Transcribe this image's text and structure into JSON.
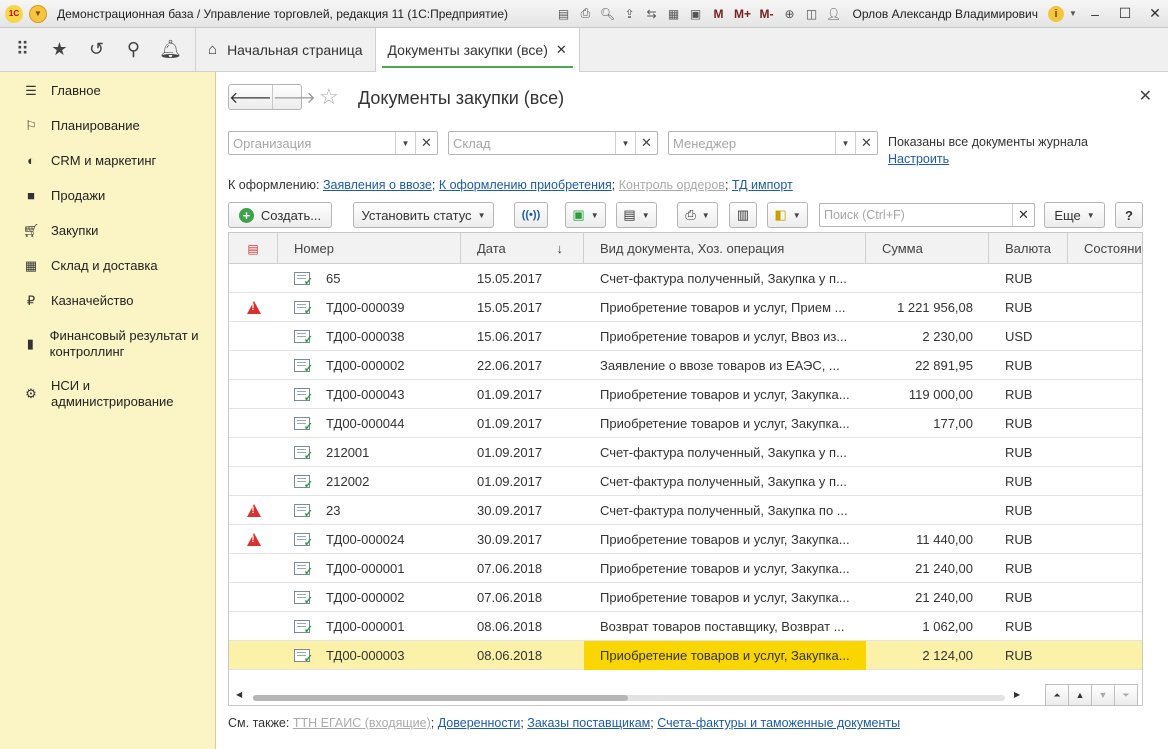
{
  "window": {
    "title": "Демонстрационная база / Управление торговлей, редакция 11  (1С:Предприятие)",
    "user": "Орлов Александр Владимирович",
    "toolbar_icons": [
      "save-icon",
      "print-icon",
      "preview-icon",
      "upload-icon",
      "compare-icon",
      "calculator-icon",
      "calendar-icon"
    ],
    "memory_labels": [
      "M",
      "M+",
      "M-"
    ]
  },
  "tabs": {
    "home": "Начальная страница",
    "active": "Документы закупки (все)"
  },
  "sidebar": {
    "items": [
      {
        "label": "Главное",
        "icon": "menu-icon"
      },
      {
        "label": "Планирование",
        "icon": "planning-icon"
      },
      {
        "label": "CRM и маркетинг",
        "icon": "crm-icon"
      },
      {
        "label": "Продажи",
        "icon": "bag-icon"
      },
      {
        "label": "Закупки",
        "icon": "cart-icon"
      },
      {
        "label": "Склад и доставка",
        "icon": "warehouse-icon"
      },
      {
        "label": "Казначейство",
        "icon": "ruble-icon"
      },
      {
        "label": "Финансовый результат и контроллинг",
        "icon": "chart-icon"
      },
      {
        "label": "НСИ и администрирование",
        "icon": "gear-icon"
      }
    ]
  },
  "page": {
    "title": "Документы закупки (все)"
  },
  "filters": {
    "org_placeholder": "Организация",
    "warehouse_placeholder": "Склад",
    "manager_placeholder": "Менеджер",
    "journal_info": "Показаны все документы журнала",
    "configure_link": "Настроить"
  },
  "process": {
    "label": "К оформлению:",
    "links": [
      "Заявления о ввозе",
      "К оформлению приобретения",
      "Контроль ордеров",
      "ТД импорт"
    ]
  },
  "toolbar": {
    "create": "Создать...",
    "set_status": "Установить статус",
    "search_placeholder": "Поиск (Ctrl+F)",
    "more": "Еще",
    "help": "?"
  },
  "table": {
    "columns": [
      "Номер",
      "Дата",
      "Вид документа, Хоз. операция",
      "Сумма",
      "Валюта",
      "Состояние"
    ],
    "rows": [
      {
        "warn": false,
        "num": "65",
        "date": "15.05.2017",
        "kind": "Счет-фактура полученный, Закупка у п...",
        "sum": "",
        "cur": "RUB"
      },
      {
        "warn": true,
        "num": "ТД00-000039",
        "date": "15.05.2017",
        "kind": "Приобретение товаров и услуг, Прием ...",
        "sum": "1 221 956,08",
        "cur": "RUB"
      },
      {
        "warn": false,
        "num": "ТД00-000038",
        "date": "15.06.2017",
        "kind": "Приобретение товаров и услуг, Ввоз из...",
        "sum": "2 230,00",
        "cur": "USD"
      },
      {
        "warn": false,
        "num": "ТД00-000002",
        "date": "22.06.2017",
        "kind": "Заявление о ввозе товаров из ЕАЭС, ...",
        "sum": "22 891,95",
        "cur": "RUB"
      },
      {
        "warn": false,
        "num": "ТД00-000043",
        "date": "01.09.2017",
        "kind": "Приобретение товаров и услуг, Закупка...",
        "sum": "119 000,00",
        "cur": "RUB"
      },
      {
        "warn": false,
        "num": "ТД00-000044",
        "date": "01.09.2017",
        "kind": "Приобретение товаров и услуг, Закупка...",
        "sum": "177,00",
        "cur": "RUB"
      },
      {
        "warn": false,
        "num": "212001",
        "date": "01.09.2017",
        "kind": "Счет-фактура полученный, Закупка у п...",
        "sum": "",
        "cur": "RUB"
      },
      {
        "warn": false,
        "num": "212002",
        "date": "01.09.2017",
        "kind": "Счет-фактура полученный, Закупка у п...",
        "sum": "",
        "cur": "RUB"
      },
      {
        "warn": true,
        "num": "23",
        "date": "30.09.2017",
        "kind": "Счет-фактура полученный, Закупка по ...",
        "sum": "",
        "cur": "RUB"
      },
      {
        "warn": true,
        "num": "ТД00-000024",
        "date": "30.09.2017",
        "kind": "Приобретение товаров и услуг, Закупка...",
        "sum": "11 440,00",
        "cur": "RUB"
      },
      {
        "warn": false,
        "num": "ТД00-000001",
        "date": "07.06.2018",
        "kind": "Приобретение товаров и услуг, Закупка...",
        "sum": "21 240,00",
        "cur": "RUB"
      },
      {
        "warn": false,
        "num": "ТД00-000002",
        "date": "07.06.2018",
        "kind": "Приобретение товаров и услуг, Закупка...",
        "sum": "21 240,00",
        "cur": "RUB"
      },
      {
        "warn": false,
        "num": "ТД00-000001",
        "date": "08.06.2018",
        "kind": "Возврат товаров поставщику, Возврат ...",
        "sum": "1 062,00",
        "cur": "RUB"
      },
      {
        "warn": false,
        "num": "ТД00-000003",
        "date": "08.06.2018",
        "kind": "Приобретение товаров и услуг, Закупка...",
        "sum": "2 124,00",
        "cur": "RUB",
        "selected": true
      }
    ]
  },
  "see_also": {
    "label": "См. также:",
    "links": [
      "ТТН ЕГАИС (входящие)",
      "Доверенности",
      "Заказы поставщикам",
      "Счета-фактуры и таможенные документы"
    ]
  },
  "colors": {
    "sidebar_bg": "#fbf4c5",
    "selected_row": "#fcf1a8",
    "selected_cell": "#f9d600",
    "link": "#1c5ca8",
    "warning": "#d9322e",
    "accent_green": "#4aa855"
  }
}
